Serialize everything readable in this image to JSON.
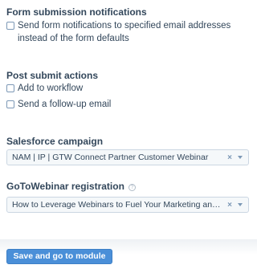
{
  "form_submission_notifications": {
    "title": "Form submission notifications",
    "option_label": "Send form notifications to specified email addresses instead of the form defaults",
    "checked": false
  },
  "post_submit_actions": {
    "title": "Post submit actions",
    "options": [
      {
        "label": "Add to workflow",
        "checked": false
      },
      {
        "label": "Send a follow-up email",
        "checked": false
      }
    ]
  },
  "salesforce_campaign": {
    "title": "Salesforce campaign",
    "selected_value": "NAM | IP | GTW Connect Partner Customer Webinar",
    "clear_glyph": "×"
  },
  "gotowebinar_registration": {
    "title": "GoToWebinar registration",
    "help_glyph": "?",
    "selected_value": "How to Leverage Webinars to Fuel Your Marketing and Sales Engine",
    "clear_glyph": "×"
  },
  "footer": {
    "save_label": "Save and go to module list"
  },
  "colors": {
    "text": "#33475b",
    "primary_button": "#4a8fd8",
    "checkbox_border": "#7c98b6",
    "input_background": "#f5f8fa"
  }
}
